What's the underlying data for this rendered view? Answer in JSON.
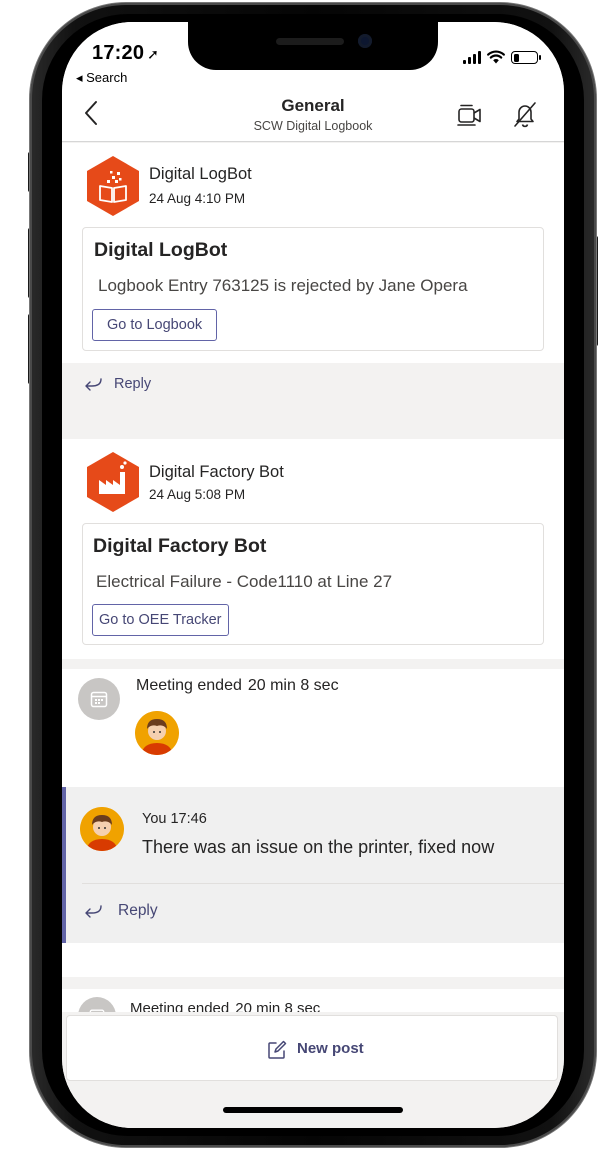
{
  "status_bar": {
    "time": "17:20",
    "back_label": "◂ Search",
    "battery_level_percent": 25
  },
  "header": {
    "title": "General",
    "subtitle": "SCW Digital Logbook"
  },
  "posts": [
    {
      "sender": "Digital LogBot",
      "timestamp": "24 Aug 4:10 PM",
      "avatar_color": "#e64a19",
      "card_title": "Digital LogBot",
      "card_text": "Logbook Entry 763125 is rejected by Jane Opera",
      "button_label": "Go to Logbook",
      "reply_label": "Reply"
    },
    {
      "sender": "Digital Factory Bot",
      "timestamp": "24 Aug 5:08 PM",
      "avatar_color": "#e64a19",
      "card_title": "Digital Factory Bot",
      "card_text": "Electrical Failure - Code1110 at Line 27",
      "button_label": "Go to OEE Tracker"
    }
  ],
  "meetings": [
    {
      "label": "Meeting ended",
      "duration": "20 min 8 sec"
    },
    {
      "label": "Meeting ended",
      "duration": "20 min 8 sec"
    }
  ],
  "my_message": {
    "meta": "You 17:46",
    "text": "There was an issue on the printer, fixed now",
    "reply_label": "Reply"
  },
  "new_post": {
    "label": "New post"
  },
  "colors": {
    "accent": "#6264a7",
    "bot_orange": "#e64a19",
    "avatar_yellow": "#f0a200"
  }
}
